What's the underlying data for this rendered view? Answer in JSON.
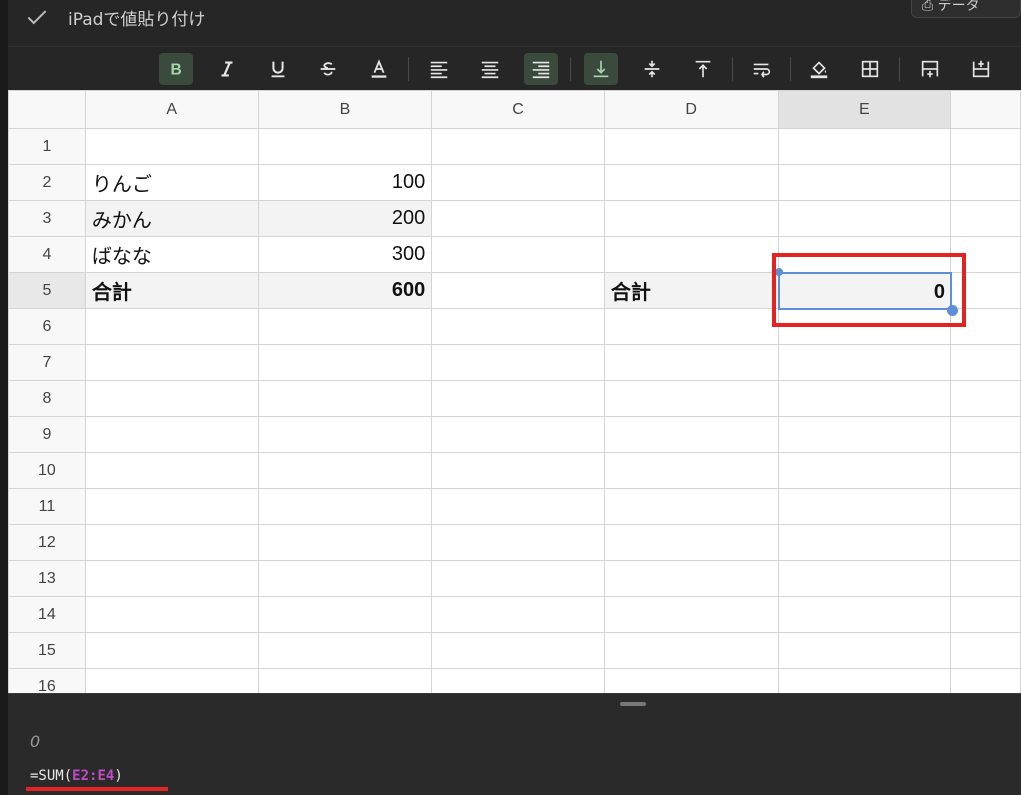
{
  "topbar": {
    "title": "iPadで値貼り付け",
    "right_label": "⎙ データ"
  },
  "toolbar": {
    "buttons": [
      "bold",
      "italic",
      "underline",
      "strikethrough",
      "text-color",
      "align-left",
      "align-center",
      "align-right",
      "valign-bottom",
      "valign-middle",
      "valign-top",
      "wrap-text",
      "fill-color",
      "borders",
      "insert-row-above",
      "insert-row-below"
    ],
    "active": [
      "bold",
      "align-right",
      "valign-bottom"
    ]
  },
  "columns": [
    "A",
    "B",
    "C",
    "D",
    "E"
  ],
  "rows": [
    {
      "n": "1",
      "a": "",
      "b": "",
      "d": ""
    },
    {
      "n": "2",
      "a": "りんご",
      "b": "100",
      "d": ""
    },
    {
      "n": "3",
      "a": "みかん",
      "b": "200",
      "d": ""
    },
    {
      "n": "4",
      "a": "ばなな",
      "b": "300",
      "d": ""
    },
    {
      "n": "5",
      "a": "合計",
      "b": "600",
      "d": "合計"
    },
    {
      "n": "6"
    },
    {
      "n": "7"
    },
    {
      "n": "8"
    },
    {
      "n": "9"
    },
    {
      "n": "10"
    },
    {
      "n": "11"
    },
    {
      "n": "12"
    },
    {
      "n": "13"
    },
    {
      "n": "14"
    },
    {
      "n": "15"
    },
    {
      "n": "16"
    }
  ],
  "selected_cell": {
    "ref": "E5",
    "value": "0"
  },
  "formula_panel": {
    "result_preview": "0",
    "formula_prefix": "=SUM(",
    "formula_range": "E2:E4",
    "formula_suffix": ")"
  },
  "colors": {
    "accent": "#5b8fd6",
    "highlight": "#e32222",
    "range_ref": "#c04cc8"
  }
}
